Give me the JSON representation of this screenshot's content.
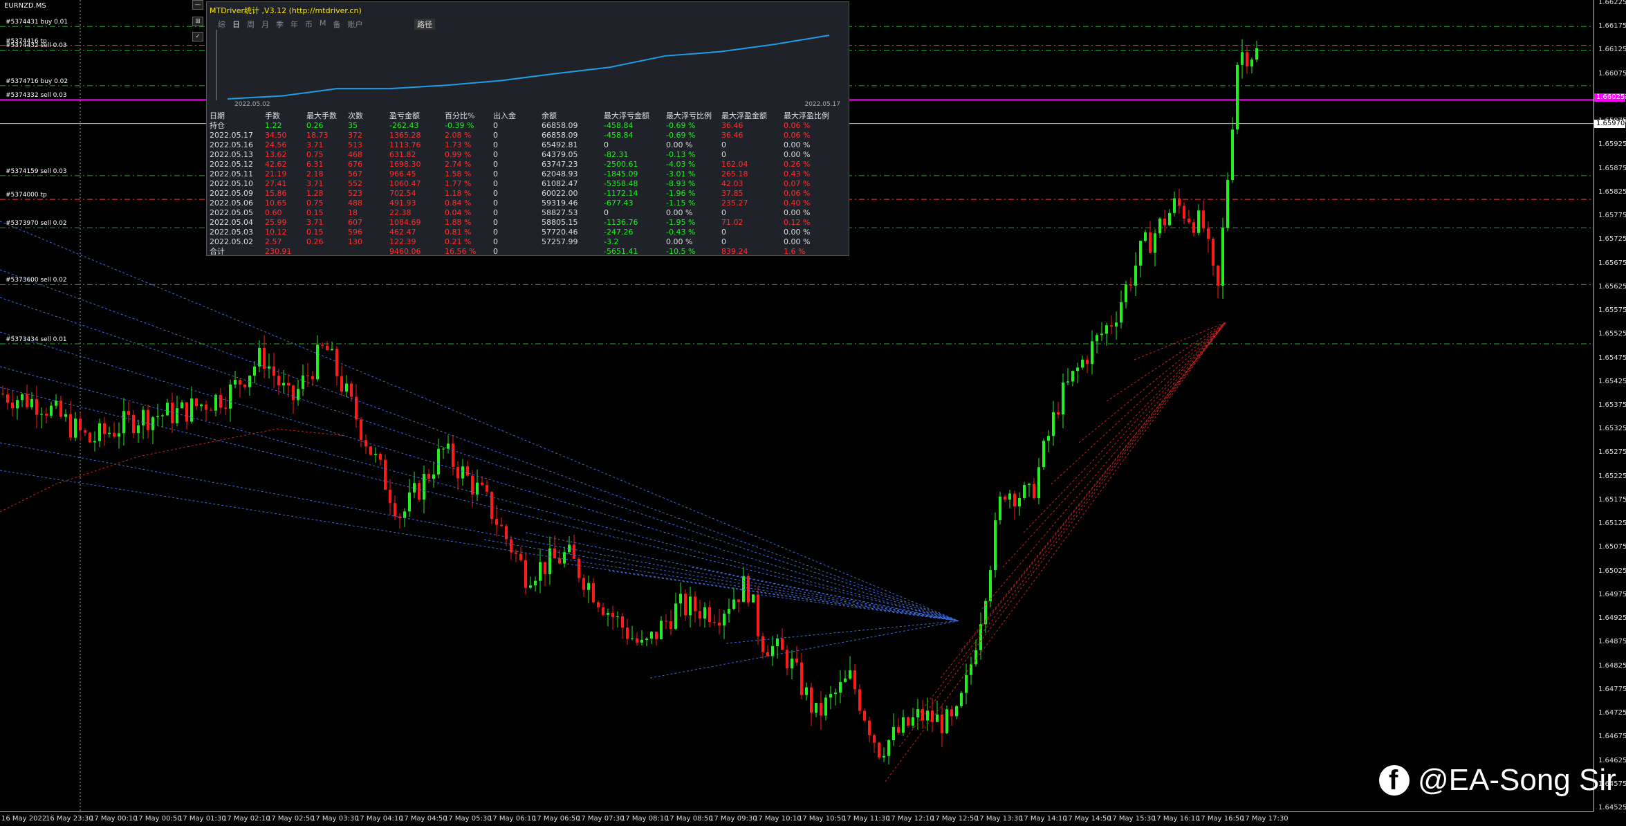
{
  "chart": {
    "symbol_title": "EURNZD.MS",
    "price_ticks": [
      "1.66225",
      "1.66175",
      "1.66125",
      "1.66075",
      "1.66025",
      "1.65975",
      "1.65925",
      "1.65875",
      "1.65825",
      "1.65775",
      "1.65725",
      "1.65675",
      "1.65625",
      "1.65575",
      "1.65525",
      "1.65475",
      "1.65425",
      "1.65375",
      "1.65325",
      "1.65275",
      "1.65225",
      "1.65175",
      "1.65125",
      "1.65075",
      "1.65025",
      "1.64975",
      "1.64925",
      "1.64875",
      "1.64825",
      "1.64775",
      "1.64725",
      "1.64675",
      "1.64625",
      "1.64575",
      "1.64525"
    ],
    "current_price": "1.65970",
    "highlight_price": "1.66025",
    "time_ticks": [
      "16 May 2022",
      "16 May 23:30",
      "17 May 00:10",
      "17 May 00:50",
      "17 May 01:30",
      "17 May 02:10",
      "17 May 02:50",
      "17 May 03:30",
      "17 May 04:10",
      "17 May 04:50",
      "17 May 05:30",
      "17 May 06:10",
      "17 May 06:50",
      "17 May 07:30",
      "17 May 08:10",
      "17 May 08:50",
      "17 May 09:30",
      "17 May 10:10",
      "17 May 10:50",
      "17 May 11:30",
      "17 May 12:10",
      "17 May 12:50",
      "17 May 13:30",
      "17 May 14:10",
      "17 May 14:50",
      "17 May 15:30",
      "17 May 16:10",
      "17 May 16:50",
      "17 May 17:30"
    ],
    "order_lines": [
      {
        "label": "#5374431 buy 0.01",
        "price": 1.66175,
        "color": "#22aa22"
      },
      {
        "label": "#5374416 tp",
        "price": 1.66135,
        "color": "#ff3030"
      },
      {
        "label": "#5374432 sell 0.03",
        "price": 1.66125,
        "color": "#22aa22"
      },
      {
        "label": "#5374716 buy 0.02",
        "price": 1.6605,
        "color": "#22aa22"
      },
      {
        "label": "#5374332 sell 0.03",
        "price": 1.6602,
        "color": "#ff00ff"
      },
      {
        "label": "#5374159 sell 0.03",
        "price": 1.6586,
        "color": "#22aa22"
      },
      {
        "label": "#5374000 tp",
        "price": 1.6581,
        "color": "#ff3030"
      },
      {
        "label": "#5373970 sell 0.02",
        "price": 1.6575,
        "color": "#22aa22"
      },
      {
        "label": "#5373600 sell 0.02",
        "price": 1.6563,
        "color": "#22aa22"
      },
      {
        "label": "#5373434 sell 0.01",
        "price": 1.65505,
        "color": "#22aa22"
      }
    ],
    "toolbar_buttons": [
      "—",
      "⊞",
      "✓"
    ]
  },
  "panel": {
    "title": "MTDriver统计 ,V3.12 (http://mtdriver.cn)",
    "tabs": [
      "综",
      "日",
      "周",
      "月",
      "季",
      "年",
      "币",
      "M",
      "备",
      "账户"
    ],
    "active_tab": "日",
    "path_tab": "路径",
    "equity_start": "2022.05.02",
    "equity_end": "2022.05.17",
    "headers": [
      "日期",
      "手数",
      "最大手数",
      "次数",
      "盈亏金额",
      "百分比%",
      "出入金",
      "余额",
      "最大浮亏金额",
      "最大浮亏比例",
      "最大浮盈金额",
      "最大浮盈比例"
    ],
    "rows": [
      [
        "持仓",
        "1.22",
        "0.26",
        "35",
        "-262.43",
        "-0.39 %",
        "0",
        "66858.09",
        "-458.84",
        "-0.69 %",
        "36.46",
        "0.06 %"
      ],
      [
        "2022.05.17",
        "34.50",
        "18.73",
        "372",
        "1365.28",
        "2.08 %",
        "0",
        "66858.09",
        "-458.84",
        "-0.69 %",
        "36.46",
        "0.06 %"
      ],
      [
        "2022.05.16",
        "24.56",
        "3.71",
        "513",
        "1113.76",
        "1.73 %",
        "0",
        "65492.81",
        "0",
        "0.00 %",
        "0",
        "0.00 %"
      ],
      [
        "2022.05.13",
        "13.62",
        "0.75",
        "468",
        "631.82",
        "0.99 %",
        "0",
        "64379.05",
        "-82.31",
        "-0.13 %",
        "0",
        "0.00 %"
      ],
      [
        "2022.05.12",
        "42.62",
        "6.31",
        "676",
        "1698.30",
        "2.74 %",
        "0",
        "63747.23",
        "-2500.61",
        "-4.03 %",
        "162.04",
        "0.26 %"
      ],
      [
        "2022.05.11",
        "21.19",
        "2.18",
        "567",
        "966.45",
        "1.58 %",
        "0",
        "62048.93",
        "-1845.09",
        "-3.01 %",
        "265.18",
        "0.43 %"
      ],
      [
        "2022.05.10",
        "27.41",
        "3.71",
        "552",
        "1060.47",
        "1.77 %",
        "0",
        "61082.47",
        "-5358.48",
        "-8.93 %",
        "42.03",
        "0.07 %"
      ],
      [
        "2022.05.09",
        "15.86",
        "1.28",
        "523",
        "702.54",
        "1.18 %",
        "0",
        "60022.00",
        "-1172.14",
        "-1.96 %",
        "37.85",
        "0.06 %"
      ],
      [
        "2022.05.06",
        "10.65",
        "0.75",
        "488",
        "491.93",
        "0.84 %",
        "0",
        "59319.46",
        "-677.43",
        "-1.15 %",
        "235.27",
        "0.40 %"
      ],
      [
        "2022.05.05",
        "0.60",
        "0.15",
        "18",
        "22.38",
        "0.04 %",
        "0",
        "58827.53",
        "0",
        "0.00 %",
        "0",
        "0.00 %"
      ],
      [
        "2022.05.04",
        "25.99",
        "3.71",
        "607",
        "1084.69",
        "1.88 %",
        "0",
        "58805.15",
        "-1136.76",
        "-1.95 %",
        "71.02",
        "0.12 %"
      ],
      [
        "2022.05.03",
        "10.12",
        "0.15",
        "596",
        "462.47",
        "0.81 %",
        "0",
        "57720.46",
        "-247.26",
        "-0.43 %",
        "0",
        "0.00 %"
      ],
      [
        "2022.05.02",
        "2.57",
        "0.26",
        "130",
        "122.39",
        "0.21 %",
        "0",
        "57257.99",
        "-3.2",
        "0.00 %",
        "0",
        "0.00 %"
      ],
      [
        "合计",
        "230.91",
        "",
        "",
        "9460.06",
        "16.56 %",
        "0",
        "",
        "-5651.41",
        "-10.5 %",
        "839.24",
        "1.6 %"
      ]
    ],
    "equity_curve": [
      57257.99,
      57720.46,
      58805.15,
      58827.53,
      59319.46,
      60022.0,
      61082.47,
      62048.93,
      63747.23,
      64379.05,
      65492.81,
      66858.09
    ]
  },
  "watermark": {
    "icon": "facebook-icon",
    "text": "@EA-Song Sir"
  },
  "colors": {
    "bull": "#22ee22",
    "bear": "#ff1a1a",
    "grid": "#444",
    "panel_bg": "#1f2329",
    "equity_line": "#1e9ee8"
  }
}
